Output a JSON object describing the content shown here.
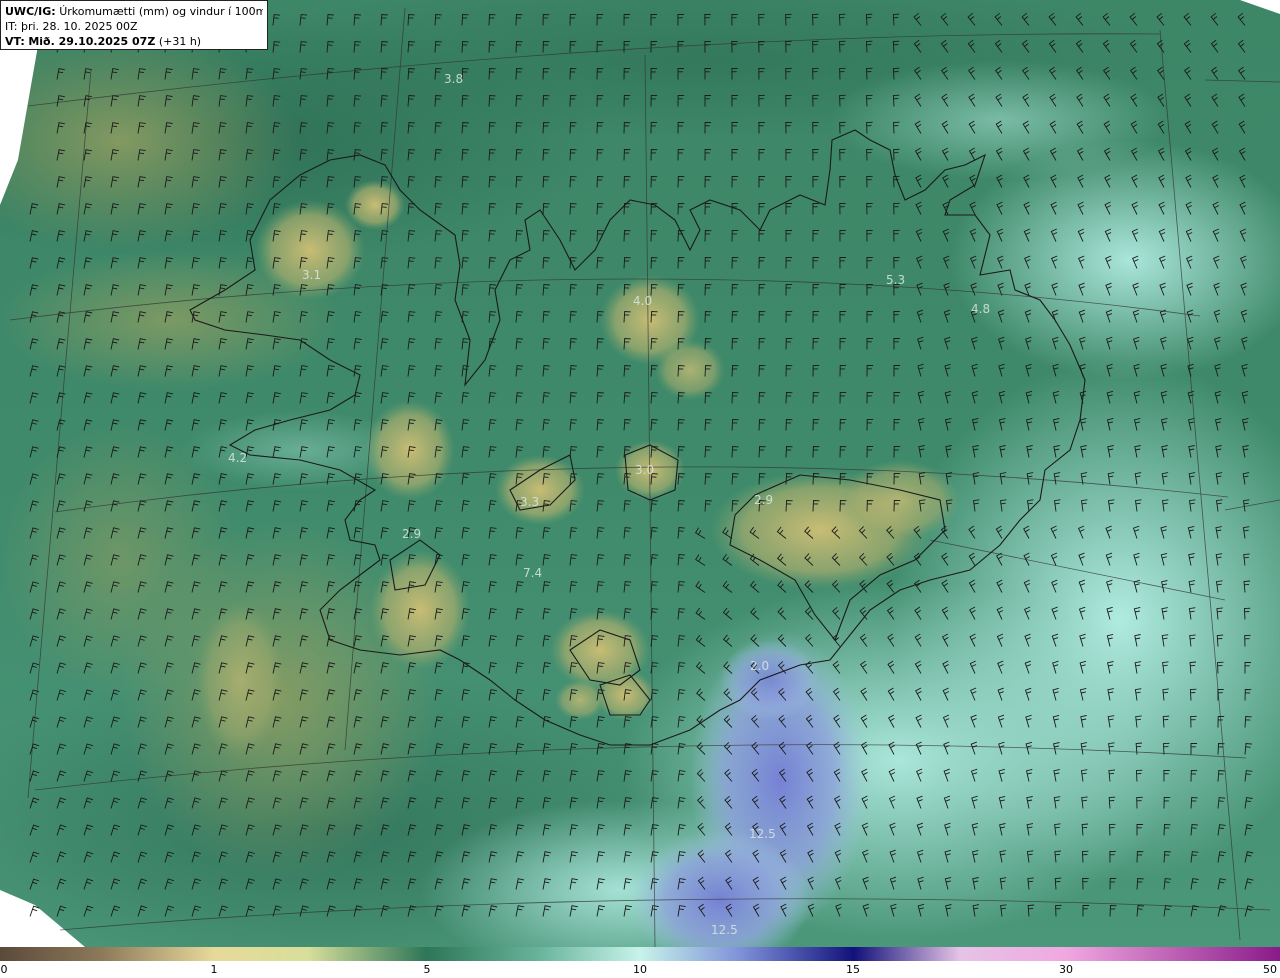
{
  "header": {
    "model": "UWC/IG:",
    "title": "Úrkomumætti (mm) og vindur í 100m hæð",
    "initial_time": "IT: þri. 28. 10. 2025 00Z",
    "valid_prefix": "VT:",
    "valid_time": "Mið. 29.10.2025 07Z",
    "lead_time": "(+31 h)"
  },
  "colorbar": {
    "ticks": [
      "0",
      "1",
      "5",
      "10",
      "15",
      "30",
      "50"
    ]
  },
  "map_labels": [
    "3.8",
    "3.1",
    "4.0",
    "5.3",
    "4.8",
    "3.0",
    "4.2",
    "3.3",
    "2.9",
    "2.9",
    "7.4",
    "2.0",
    "12.5",
    "12.5"
  ],
  "colors": {
    "low_tan": "#c8bb72",
    "mid_green": "#3f8a6b",
    "dark_green": "#2e6e55",
    "cyan": "#a9e8dc",
    "blue": "#7f89d6",
    "coast": "#1a1a1a"
  }
}
